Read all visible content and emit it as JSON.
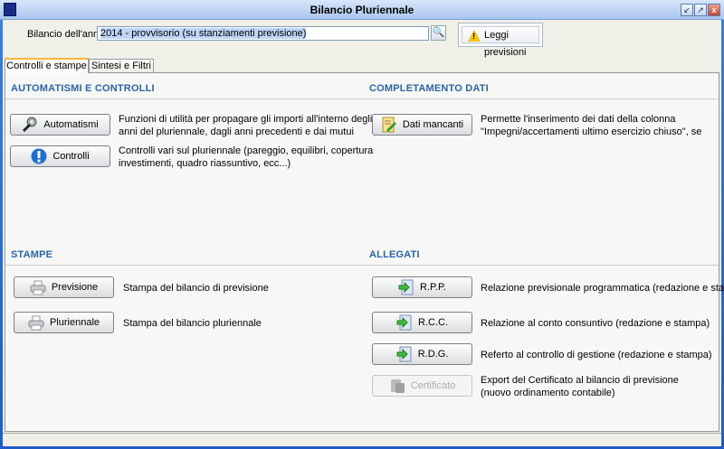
{
  "window": {
    "title": "Bilancio Pluriennale",
    "controls": [
      "minimize",
      "maximize",
      "close"
    ]
  },
  "header": {
    "year_label": "Bilancio dell'anno:",
    "year_value": "2014 - provvisorio (su stanziamenti previsione)",
    "read_button": "Leggi previsioni"
  },
  "tabs": [
    {
      "label": "Controlli e stampe",
      "active": true
    },
    {
      "label": "Sintesi e Filtri",
      "active": false
    }
  ],
  "automatismi": {
    "title": "AUTOMATISMI E CONTROLLI",
    "items": [
      {
        "label": "Automatismi",
        "icon": "tools-icon",
        "desc1": "Funzioni di utilità per propagare gli importi all'interno degli",
        "desc2": "anni del pluriennale, dagli anni precedenti e dai mutui"
      },
      {
        "label": "Controlli",
        "icon": "exclamation-icon",
        "desc1": "Controlli vari sul pluriennale (pareggio, equilibri, copertura",
        "desc2": "investimenti, quadro riassuntivo, ecc...)"
      }
    ]
  },
  "completamento": {
    "title": "COMPLETAMENTO DATI",
    "items": [
      {
        "label": "Dati mancanti",
        "icon": "edit-document-icon",
        "desc1": "Permette l'inserimento dei dati della colonna",
        "desc2": "\"Impegni/accertamenti ultimo esercizio chiuso\", se"
      }
    ]
  },
  "stampe": {
    "title": "STAMPE",
    "items": [
      {
        "label": "Previsione",
        "icon": "printer-icon",
        "desc": "Stampa del bilancio di previsione"
      },
      {
        "label": "Pluriennale",
        "icon": "printer-icon",
        "desc": "Stampa del bilancio pluriennale"
      }
    ]
  },
  "allegati": {
    "title": "ALLEGATI",
    "items": [
      {
        "label": "R.P.P.",
        "icon": "document-arrow-icon",
        "desc1": "Relazione previsionale programmatica (redazione e stampa)"
      },
      {
        "label": "R.C.C.",
        "icon": "document-arrow-icon",
        "desc1": "Relazione al conto consuntivo (redazione e stampa)"
      },
      {
        "label": "R.D.G.",
        "icon": "document-arrow-icon",
        "desc1": "Referto al controllo di gestione (redazione e stampa)"
      },
      {
        "label": "Certificato",
        "icon": "export-icon",
        "disabled": true,
        "desc1": "Export del Certificato al bilancio di previsione",
        "desc2": "(nuovo ordinamento contabile)"
      }
    ]
  },
  "colors": {
    "section_title": "#2a64a8",
    "titlebar": "#a9c5ee"
  }
}
